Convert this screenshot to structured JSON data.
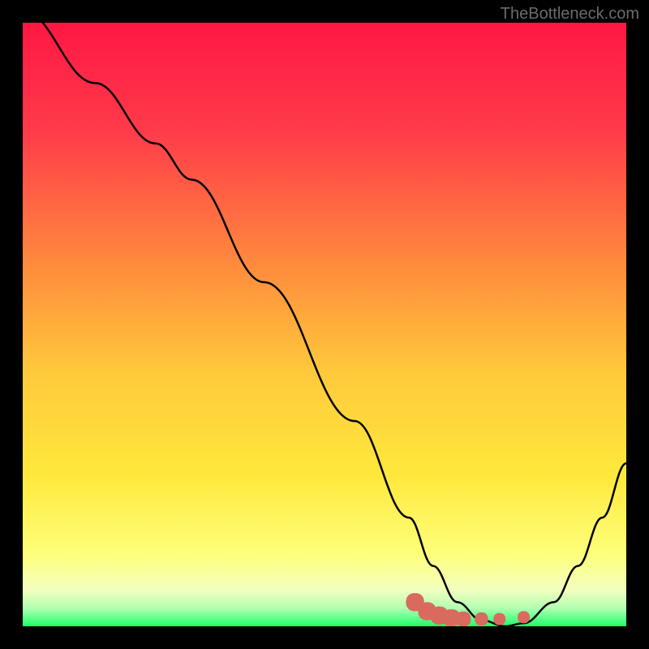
{
  "watermark": "TheBottleneck.com",
  "chart_data": {
    "type": "line",
    "title": "",
    "xlabel": "",
    "ylabel": "",
    "xlim": [
      0,
      100
    ],
    "ylim": [
      0,
      100
    ],
    "gradient_stops": [
      {
        "offset": 0,
        "color": "#ff1744"
      },
      {
        "offset": 18,
        "color": "#ff3b4a"
      },
      {
        "offset": 40,
        "color": "#ff8a3d"
      },
      {
        "offset": 58,
        "color": "#ffc93c"
      },
      {
        "offset": 75,
        "color": "#ffe83c"
      },
      {
        "offset": 88,
        "color": "#feff7a"
      },
      {
        "offset": 94,
        "color": "#f2ffbf"
      },
      {
        "offset": 97,
        "color": "#b2ffb2"
      },
      {
        "offset": 100,
        "color": "#1dff6a"
      }
    ],
    "series": [
      {
        "name": "bottleneck-curve",
        "color": "#000000",
        "x": [
          0,
          12,
          22,
          28,
          40,
          55,
          64,
          68,
          72,
          76,
          80,
          83,
          88,
          92,
          96,
          100
        ],
        "y": [
          102,
          90,
          80,
          74,
          57,
          34,
          18,
          10,
          4,
          1,
          0,
          0.5,
          4,
          10,
          18,
          27
        ]
      }
    ],
    "markers": {
      "name": "highlight-markers",
      "color": "#d96a5e",
      "shape": "rounded",
      "points": [
        {
          "x": 65,
          "y": 4,
          "w": 3,
          "h": 3
        },
        {
          "x": 67,
          "y": 2.5,
          "w": 3,
          "h": 3
        },
        {
          "x": 69,
          "y": 1.8,
          "w": 3,
          "h": 3
        },
        {
          "x": 71,
          "y": 1.4,
          "w": 3,
          "h": 2.8
        },
        {
          "x": 73,
          "y": 1.2,
          "w": 2.5,
          "h": 2.5
        },
        {
          "x": 76,
          "y": 1.2,
          "w": 2.2,
          "h": 2.2
        },
        {
          "x": 79,
          "y": 1.2,
          "w": 2,
          "h": 2
        },
        {
          "x": 83,
          "y": 1.5,
          "w": 2,
          "h": 2
        }
      ]
    }
  }
}
